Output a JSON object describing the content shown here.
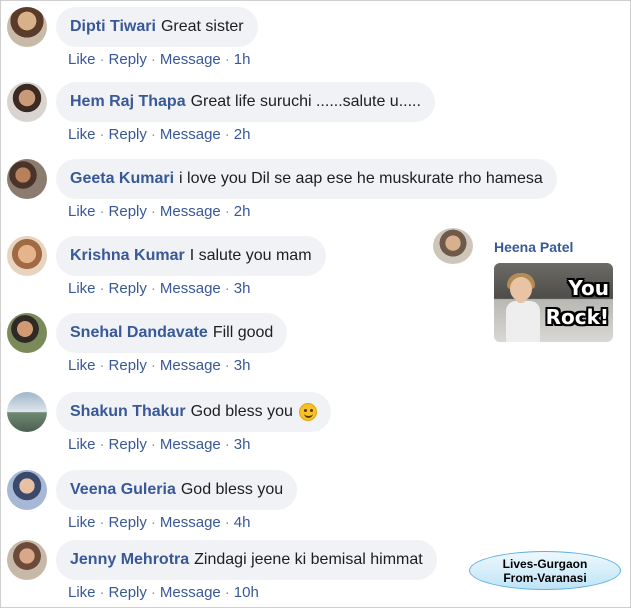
{
  "actions": {
    "like": "Like",
    "reply": "Reply",
    "message": "Message",
    "separator": "·"
  },
  "comments": [
    {
      "name": "Dipti Tiwari",
      "text": "Great sister",
      "time": "1h",
      "emoji": ""
    },
    {
      "name": "Hem Raj Thapa",
      "text": "Great life suruchi ......salute u.....",
      "time": "2h",
      "emoji": ""
    },
    {
      "name": "Geeta Kumari",
      "text": "i love you Dil se aap ese he muskurate rho hamesa",
      "time": "2h",
      "emoji": ""
    },
    {
      "name": "Krishna Kumar",
      "text": "I salute you mam",
      "time": "3h",
      "emoji": ""
    },
    {
      "name": "Snehal Dandavate",
      "text": "Fill good",
      "time": "3h",
      "emoji": ""
    },
    {
      "name": "Shakun Thakur",
      "text": "God bless you",
      "time": "3h",
      "emoji": "smiling-face"
    },
    {
      "name": "Veena Guleria",
      "text": "God bless you",
      "time": "4h",
      "emoji": ""
    },
    {
      "name": "Jenny Mehrotra",
      "text": "Zindagi jeene ki bemisal himmat",
      "time": "10h",
      "emoji": ""
    }
  ],
  "side_comment": {
    "name": "Heena Patel",
    "gif_text": [
      "You",
      "Rock!"
    ]
  },
  "tag": {
    "line1": "Lives-Gurgaon",
    "line2": "From-Varanasi"
  },
  "colors": {
    "link": "#385898",
    "bubble": "#f0f2f5",
    "text": "#1c1e21"
  }
}
